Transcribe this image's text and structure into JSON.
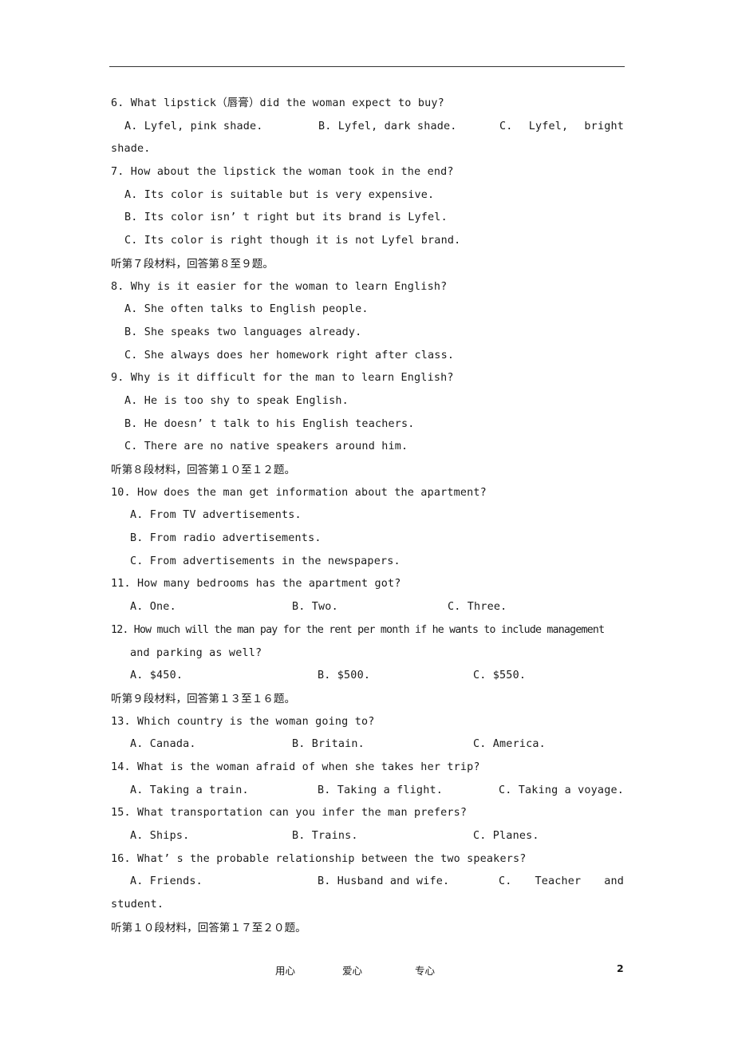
{
  "questions": {
    "q6": {
      "text": "6. What lipstick（唇膏）did the woman expect to buy?",
      "a": "A. Lyfel, pink shade.",
      "b": "B. Lyfel, dark shade.",
      "c_part1": "C.",
      "c_part2": "Lyfel,",
      "c_part3": "bright",
      "c_cont": "shade."
    },
    "q7": {
      "text": "7. How about the lipstick the woman took in the end?",
      "a": "A. Its color is suitable but is very expensive.",
      "b": "B. Its color isn’ t right but its brand is Lyfel.",
      "c": "C. Its color is right though it is not Lyfel brand."
    },
    "section7": "听第７段材料，回答第８至９题。",
    "q8": {
      "text": "8. Why is it easier for the woman to learn English?",
      "a": "A. She often talks to English people.",
      "b": "B. She speaks two languages already.",
      "c": "C. She always does her homework right after class."
    },
    "q9": {
      "text": "9. Why is it difficult for the man to learn English?",
      "a": "A. He is too shy to speak English.",
      "b": "B. He doesn’ t talk to his English teachers.",
      "c": "C. There are no native speakers around him."
    },
    "section8": "听第８段材料，回答第１０至１２题。",
    "q10": {
      "text": "10. How does the man get information about the apartment?",
      "a": "A. From TV advertisements.",
      "b": "B. From radio advertisements.",
      "c": "C. From advertisements in the newspapers."
    },
    "q11": {
      "text": "11. How many bedrooms has the apartment got?",
      "a": "A. One.",
      "b": "B. Two.",
      "c": "C. Three."
    },
    "q12": {
      "text": "12. How much will the man pay for the rent per month if he wants to include management",
      "text_cont": "and parking as well?",
      "a": "A. $450.",
      "b": "B. $500.",
      "c": "C. $550."
    },
    "section9": "听第９段材料，回答第１３至１６题。",
    "q13": {
      "text": "13. Which country is the woman going to?",
      "a": "A. Canada.",
      "b": "B. Britain.",
      "c": "C. America."
    },
    "q14": {
      "text": "14. What is the woman afraid of when she takes her trip?",
      "a": "A. Taking a train.",
      "b": "B. Taking a flight.",
      "c": "C. Taking a voyage."
    },
    "q15": {
      "text": "15. What transportation can you infer the man prefers?",
      "a": "A. Ships.",
      "b": "B. Trains.",
      "c": "C. Planes."
    },
    "q16": {
      "text": "16. What’ s the probable relationship between the two speakers?",
      "a": "A. Friends.",
      "b": "B. Husband and wife.",
      "c_part1": "C.",
      "c_part2": "Teacher",
      "c_part3": "and",
      "c_cont": "student."
    },
    "section10": "听第１０段材料，回答第１７至２０题。"
  },
  "footer": {
    "motto1": "用心",
    "motto2": "爱心",
    "motto3": "专心",
    "page_number": "2"
  }
}
